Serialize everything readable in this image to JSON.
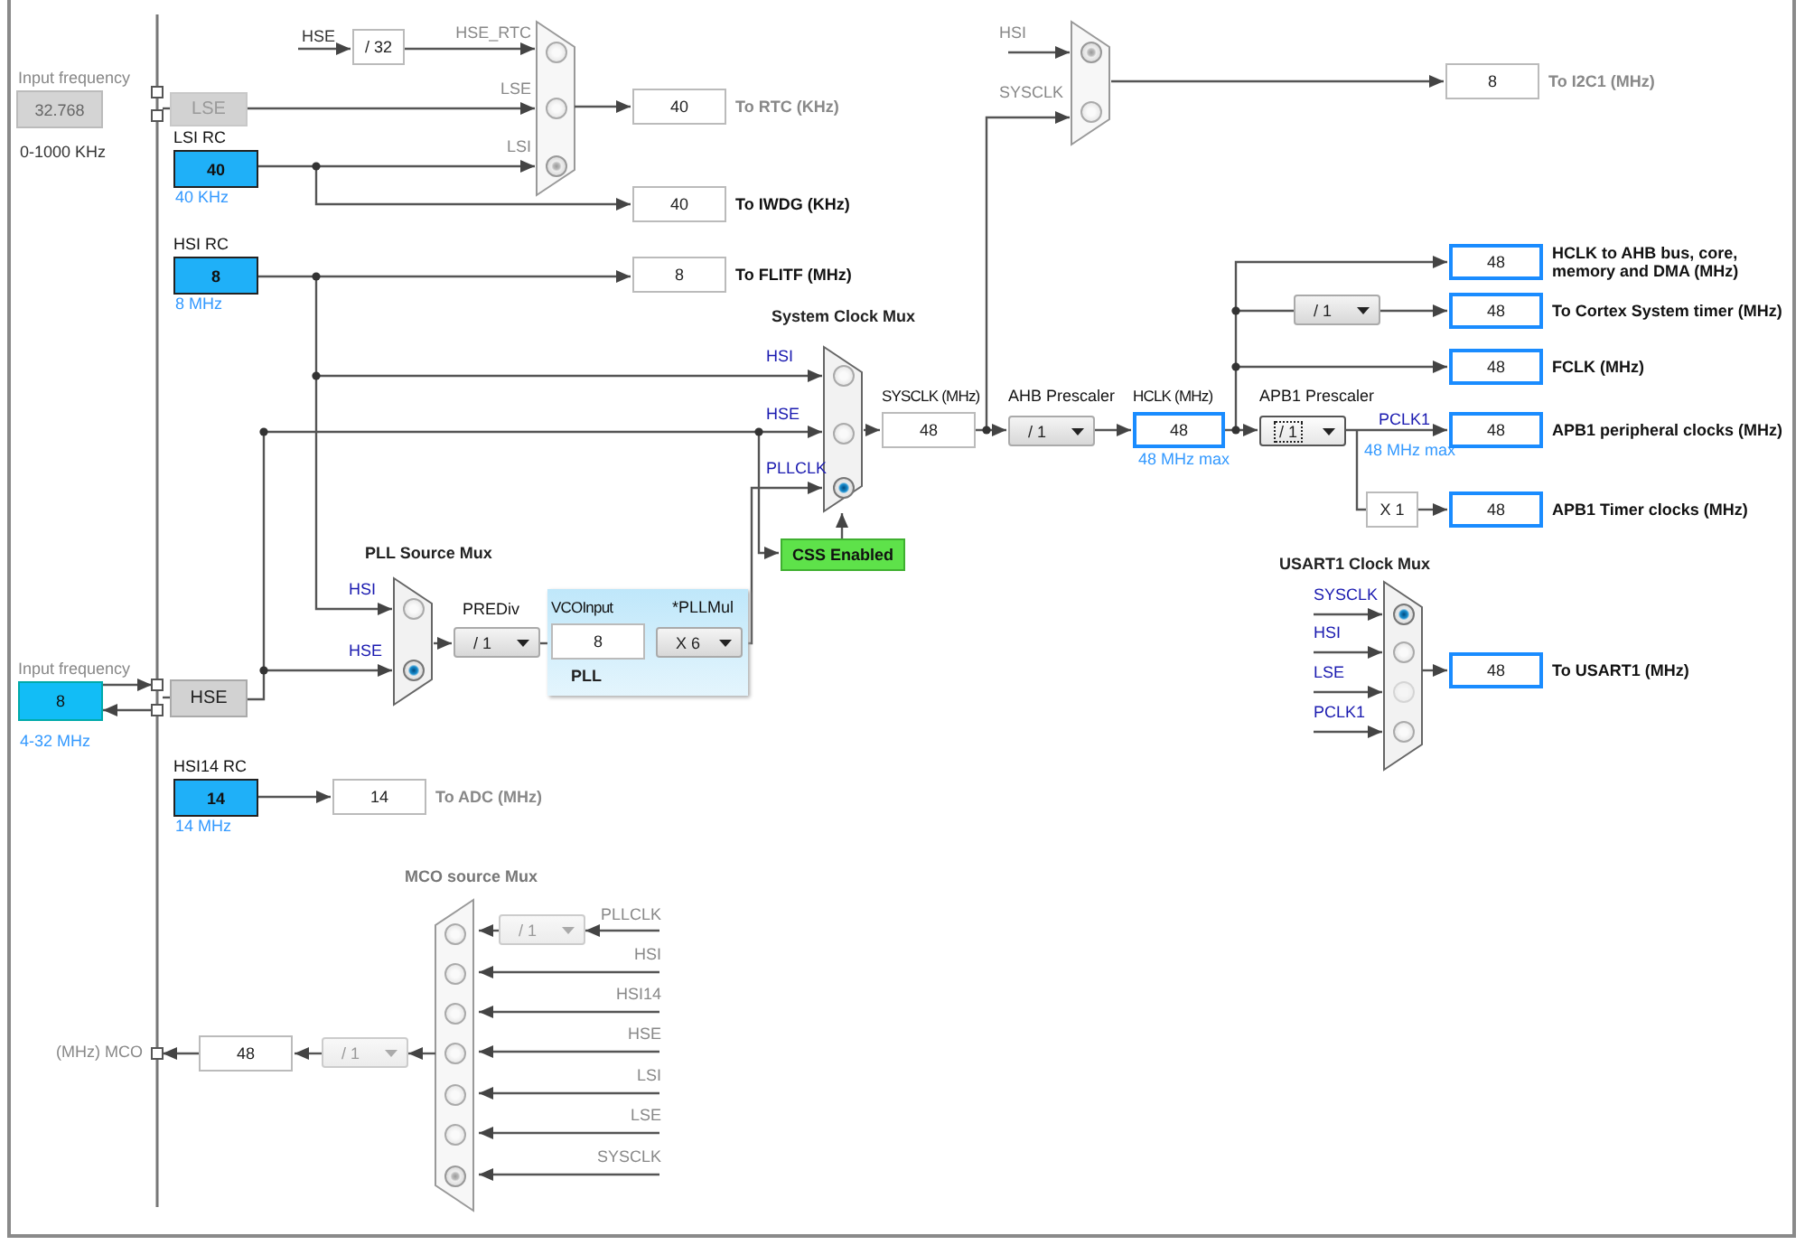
{
  "lse_source": {
    "title": "Input frequency",
    "value": "32.768",
    "range": "0-1000 KHz",
    "name": "LSE",
    "enabled": false
  },
  "hse_source": {
    "title": "Input frequency",
    "value": "8",
    "range": "4-32 MHz",
    "name": "HSE",
    "enabled": true
  },
  "rc_oscillators": [
    {
      "title": "LSI RC",
      "value": "40",
      "freq": "40 KHz"
    },
    {
      "title": "HSI RC",
      "value": "8",
      "freq": "8 MHz"
    },
    {
      "title": "HSI14 RC",
      "value": "14",
      "freq": "14 MHz"
    }
  ],
  "signal_labels": [
    {
      "text": "HSE",
      "kind": "name"
    },
    {
      "text": "PCLK1",
      "kind": "signal"
    },
    {
      "text": "48 MHz max",
      "kind": "note"
    }
  ],
  "muxes": [
    {
      "enabled": false,
      "inputs": [
        {
          "label": "HSE_RTC",
          "selected": false,
          "disabled": false
        },
        {
          "label": "LSE",
          "selected": false,
          "disabled": false
        },
        {
          "label": "LSI",
          "selected": true,
          "disabled": false
        }
      ]
    },
    {
      "enabled": false,
      "inputs": [
        {
          "label": "HSI",
          "selected": true,
          "disabled": false
        },
        {
          "label": "SYSCLK",
          "selected": false,
          "disabled": false
        }
      ]
    },
    {
      "title": "System Clock Mux",
      "enabled": true,
      "inputs": [
        {
          "label": "HSI",
          "selected": false,
          "disabled": false
        },
        {
          "label": "HSE",
          "selected": false,
          "disabled": false
        },
        {
          "label": "PLLCLK",
          "selected": true,
          "disabled": false
        }
      ]
    },
    {
      "title": "PLL Source Mux",
      "enabled": true,
      "inputs": [
        {
          "label": "HSI",
          "selected": false,
          "disabled": false
        },
        {
          "label": "HSE",
          "selected": true,
          "disabled": false
        }
      ]
    },
    {
      "title": "USART1 Clock Mux",
      "enabled": true,
      "inputs": [
        {
          "label": "SYSCLK",
          "selected": true,
          "disabled": false
        },
        {
          "label": "HSI",
          "selected": false,
          "disabled": false
        },
        {
          "label": "LSE",
          "selected": false,
          "disabled": true
        },
        {
          "label": "PCLK1",
          "selected": false,
          "disabled": false
        }
      ]
    },
    {
      "title": "MCO source Mux",
      "enabled": false,
      "inputs": [
        {
          "label": "PLLCLK",
          "selected": false,
          "disabled": false
        },
        {
          "label": "HSI",
          "selected": false,
          "disabled": false
        },
        {
          "label": "HSI14",
          "selected": false,
          "disabled": false
        },
        {
          "label": "HSE",
          "selected": false,
          "disabled": false
        },
        {
          "label": "LSI",
          "selected": false,
          "disabled": false
        },
        {
          "label": "LSE",
          "selected": false,
          "disabled": false
        },
        {
          "label": "SYSCLK",
          "selected": true,
          "disabled": false
        }
      ]
    }
  ],
  "boxes": [
    {
      "value": "/ 32",
      "highlight": false
    },
    {
      "label": "SYSCLK (MHz)",
      "value": "48",
      "highlight": false
    },
    {
      "label": "HCLK (MHz)",
      "value": "48",
      "highlight": true,
      "note": "48 MHz max"
    },
    {
      "label": "VCOInput",
      "value": "8",
      "highlight": false
    },
    {
      "value": "X 1",
      "highlight": false
    },
    {
      "value": "48",
      "highlight": false
    }
  ],
  "prescalers": [
    {
      "value": "/ 1",
      "enabled": true,
      "focused": false
    },
    {
      "label": "AHB Prescaler",
      "value": "/ 1",
      "enabled": true,
      "focused": false
    },
    {
      "label": "APB1 Prescaler",
      "value": "/ 1",
      "enabled": true,
      "focused": true
    },
    {
      "label": "PREDiv",
      "value": "/ 1",
      "enabled": true,
      "focused": false
    },
    {
      "label": "*PLLMul",
      "value": "X 6",
      "enabled": true,
      "focused": false
    },
    {
      "value": "/ 1",
      "enabled": false,
      "focused": false
    },
    {
      "value": "/ 1",
      "enabled": false,
      "focused": false
    }
  ],
  "pll": {
    "title": "PLL"
  },
  "css": {
    "label": "CSS Enabled",
    "on": true
  },
  "mco_output": {
    "label": "(MHz) MCO"
  },
  "outputs": [
    {
      "value": "40",
      "label": "To RTC (KHz)",
      "enabled": false,
      "highlight": false
    },
    {
      "value": "40",
      "label": "To IWDG (KHz)",
      "enabled": true,
      "highlight": false
    },
    {
      "value": "8",
      "label": "To FLITF (MHz)",
      "enabled": true,
      "highlight": false
    },
    {
      "value": "8",
      "label": "To I2C1 (MHz)",
      "enabled": false,
      "highlight": false
    },
    {
      "value": "48",
      "label": "HCLK to AHB bus, core,\nmemory and DMA (MHz)",
      "enabled": true,
      "highlight": true
    },
    {
      "value": "48",
      "label": "To Cortex System timer (MHz)",
      "enabled": true,
      "highlight": true
    },
    {
      "value": "48",
      "label": "FCLK (MHz)",
      "enabled": true,
      "highlight": true
    },
    {
      "value": "48",
      "label": "APB1 peripheral clocks (MHz)",
      "enabled": true,
      "highlight": true
    },
    {
      "value": "48",
      "label": "APB1 Timer clocks (MHz)",
      "enabled": true,
      "highlight": true
    },
    {
      "value": "48",
      "label": "To USART1 (MHz)",
      "enabled": true,
      "highlight": true
    },
    {
      "value": "14",
      "label": "To ADC (MHz)",
      "enabled": false,
      "highlight": false
    }
  ]
}
